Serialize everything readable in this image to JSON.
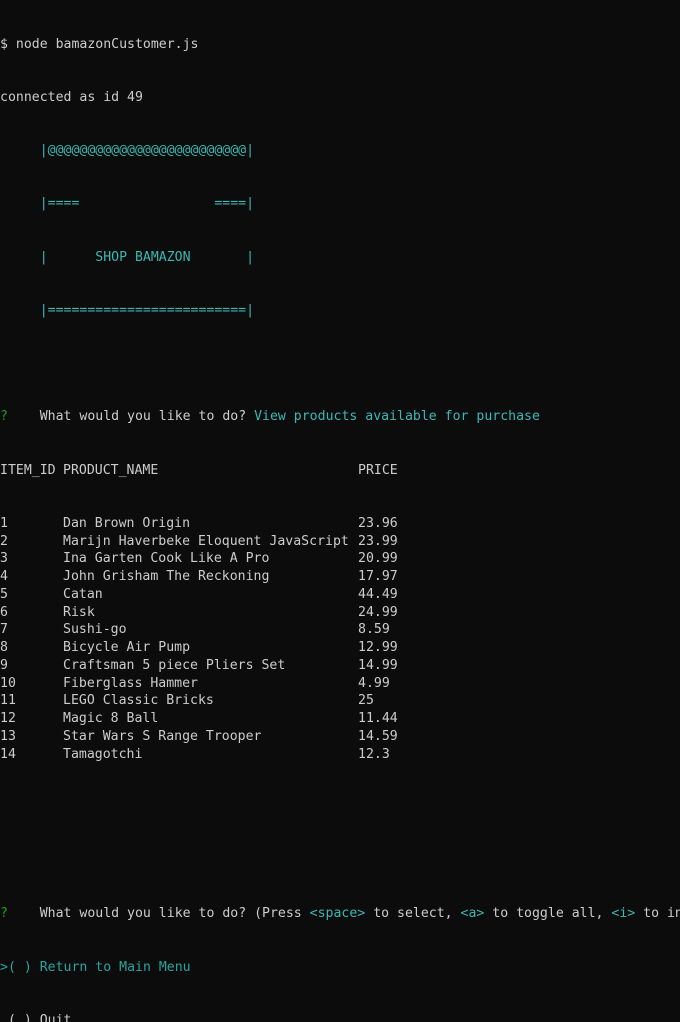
{
  "command": "$ node bamazonCustomer.js",
  "connected": "connected as id 49",
  "banner": {
    "top": "     |@@@@@@@@@@@@@@@@@@@@@@@@@|",
    "row2": "     |====                 ====|",
    "row3": "     |      SHOP BAMAZON       |",
    "row4": "     |=========================|"
  },
  "prompt1": {
    "mark": "?",
    "question": "What would you like to do?",
    "answer": "View products available for purchase"
  },
  "table": {
    "headers": [
      "ITEM_ID",
      "PRODUCT_NAME",
      "PRICE"
    ],
    "rows": [
      [
        "1",
        "Dan Brown Origin",
        "23.96"
      ],
      [
        "2",
        "Marijn Haverbeke Eloquent JavaScript",
        "23.99"
      ],
      [
        "3",
        "Ina Garten Cook Like A Pro",
        "20.99"
      ],
      [
        "4",
        "John Grisham The Reckoning",
        "17.97"
      ],
      [
        "5",
        "Catan",
        "44.49"
      ],
      [
        "6",
        "Risk",
        "24.99"
      ],
      [
        "7",
        "Sushi-go",
        "8.59"
      ],
      [
        "8",
        "Bicycle Air Pump",
        "12.99"
      ],
      [
        "9",
        "Craftsman 5 piece Pliers Set",
        "14.99"
      ],
      [
        "10",
        "Fiberglass Hammer",
        "4.99"
      ],
      [
        "11",
        "LEGO Classic Bricks",
        "25"
      ],
      [
        "12",
        "Magic 8 Ball",
        "11.44"
      ],
      [
        "13",
        "Star Wars S Range Trooper",
        "14.59"
      ],
      [
        "14",
        "Tamagotchi",
        "12.3"
      ]
    ]
  },
  "prompt2": {
    "mark": "?",
    "question": "What would you like to do? (Press ",
    "key_space": "<space>",
    "t1": " to select, ",
    "key_a": "<a>",
    "t2": " to toggle all, ",
    "key_i": "<i>",
    "t3": " to in"
  },
  "choices": [
    {
      "pointer": ">",
      "box": "( )",
      "label": "Return to Main Menu",
      "active": true
    },
    {
      "pointer": " ",
      "box": "( )",
      "label": "Quit",
      "active": false
    }
  ],
  "colors": {
    "background": "#0c0c0c",
    "text": "#cccccc",
    "cyan": "#3ab8b4",
    "green": "#13a10e"
  }
}
